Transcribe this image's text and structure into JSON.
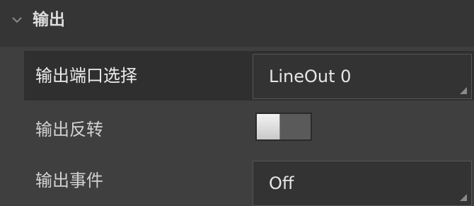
{
  "section": {
    "title": "输出",
    "expanded": true,
    "chevron_icon": "chevron-down-icon"
  },
  "rows": [
    {
      "label": "输出端口选择",
      "control": "dropdown",
      "value": "LineOut 0"
    },
    {
      "label": "输出反转",
      "control": "toggle",
      "value": false
    },
    {
      "label": "输出事件",
      "control": "dropdown",
      "value": "Off"
    }
  ]
}
